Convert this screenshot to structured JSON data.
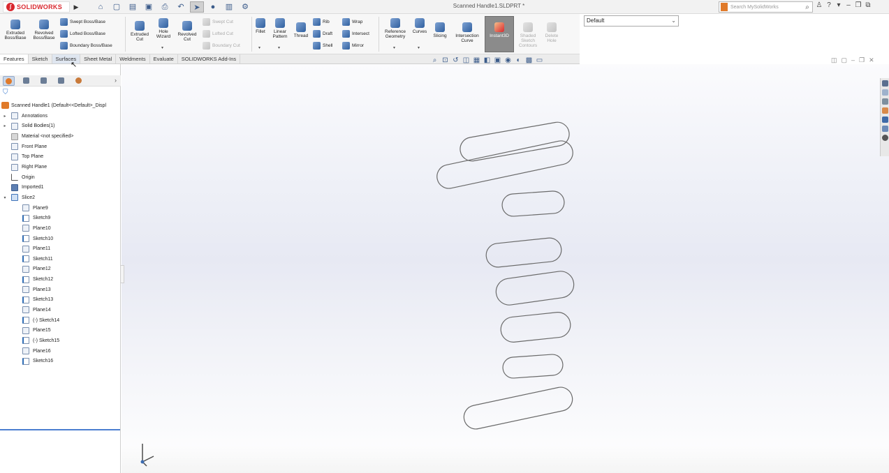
{
  "app": {
    "logo_text": "SOLIDWORKS",
    "document_title": "Scanned Handle1.SLDPRT *",
    "search_placeholder": "Search MySolidWorks",
    "configuration": "Default"
  },
  "quick_access": [
    "home-icon",
    "new-file-icon",
    "open-file-icon",
    "save-icon",
    "print-icon",
    "undo-icon",
    "select-icon",
    "rebuild-icon",
    "file-properties-icon",
    "options-icon"
  ],
  "commands": {
    "extruded_boss": "Extruded Boss/Base",
    "revolved_boss": "Revolved Boss/Base",
    "swept_boss": "Swept Boss/Base",
    "lofted_boss": "Lofted Boss/Base",
    "boundary_boss": "Boundary Boss/Base",
    "extruded_cut": "Extruded Cut",
    "hole_wizard": "Hole Wizard",
    "revolved_cut": "Revolved Cut",
    "swept_cut": "Swept Cut",
    "lofted_cut": "Lofted Cut",
    "boundary_cut": "Boundary Cut",
    "fillet": "Fillet",
    "linear_pattern": "Linear Pattern",
    "thread": "Thread",
    "rib": "Rib",
    "draft": "Draft",
    "shell": "Shell",
    "wrap": "Wrap",
    "intersect": "Intersect",
    "mirror": "Mirror",
    "reference_geometry": "Reference Geometry",
    "curves": "Curves",
    "slicing": "Slicing",
    "intersection_curve": "Intersection Curve",
    "instant3d": "Instant3D",
    "shaded_sketch_contours": "Shaded Sketch Contours",
    "delete_hole": "Delete Hole"
  },
  "tabs": [
    "Features",
    "Sketch",
    "Surfaces",
    "Sheet Metal",
    "Weldments",
    "Evaluate",
    "SOLIDWORKS Add-Ins"
  ],
  "tree": {
    "root": "Scanned Handle1 (Default<<Default>_Displ",
    "nodes": [
      {
        "label": "Annotations",
        "level": 0,
        "icon": "annotations",
        "expand": "▸"
      },
      {
        "label": "Solid Bodies(1)",
        "level": 0,
        "icon": "solid-bodies",
        "expand": "▸"
      },
      {
        "label": "Material <not specified>",
        "level": 0,
        "icon": "material",
        "expand": ""
      },
      {
        "label": "Front Plane",
        "level": 0,
        "icon": "plane",
        "expand": ""
      },
      {
        "label": "Top Plane",
        "level": 0,
        "icon": "plane",
        "expand": ""
      },
      {
        "label": "Right Plane",
        "level": 0,
        "icon": "plane",
        "expand": ""
      },
      {
        "label": "Origin",
        "level": 0,
        "icon": "origin",
        "expand": ""
      },
      {
        "label": "Imported1",
        "level": 0,
        "icon": "imported",
        "expand": ""
      },
      {
        "label": "Slice2",
        "level": 0,
        "icon": "folder",
        "expand": "▾"
      },
      {
        "label": "Plane9",
        "level": 1,
        "icon": "plane",
        "expand": ""
      },
      {
        "label": "Sketch9",
        "level": 1,
        "icon": "sketch",
        "expand": ""
      },
      {
        "label": "Plane10",
        "level": 1,
        "icon": "plane",
        "expand": ""
      },
      {
        "label": "Sketch10",
        "level": 1,
        "icon": "sketch",
        "expand": ""
      },
      {
        "label": "Plane11",
        "level": 1,
        "icon": "plane",
        "expand": ""
      },
      {
        "label": "Sketch11",
        "level": 1,
        "icon": "sketch",
        "expand": ""
      },
      {
        "label": "Plane12",
        "level": 1,
        "icon": "plane",
        "expand": ""
      },
      {
        "label": "Sketch12",
        "level": 1,
        "icon": "sketch",
        "expand": ""
      },
      {
        "label": "Plane13",
        "level": 1,
        "icon": "plane",
        "expand": ""
      },
      {
        "label": "Sketch13",
        "level": 1,
        "icon": "sketch",
        "expand": ""
      },
      {
        "label": "Plane14",
        "level": 1,
        "icon": "plane",
        "expand": ""
      },
      {
        "label": "(-) Sketch14",
        "level": 1,
        "icon": "sketch",
        "expand": ""
      },
      {
        "label": "Plane15",
        "level": 1,
        "icon": "plane",
        "expand": ""
      },
      {
        "label": "(-) Sketch15",
        "level": 1,
        "icon": "sketch",
        "expand": ""
      },
      {
        "label": "Plane16",
        "level": 1,
        "icon": "plane",
        "expand": ""
      },
      {
        "label": "Sketch16",
        "level": 1,
        "icon": "sketch",
        "expand": ""
      }
    ]
  },
  "colors": {
    "brand": "#d9272e",
    "accent": "#e07a2a",
    "selection": "#4b7ed0",
    "contour": "#6a6a6a"
  }
}
